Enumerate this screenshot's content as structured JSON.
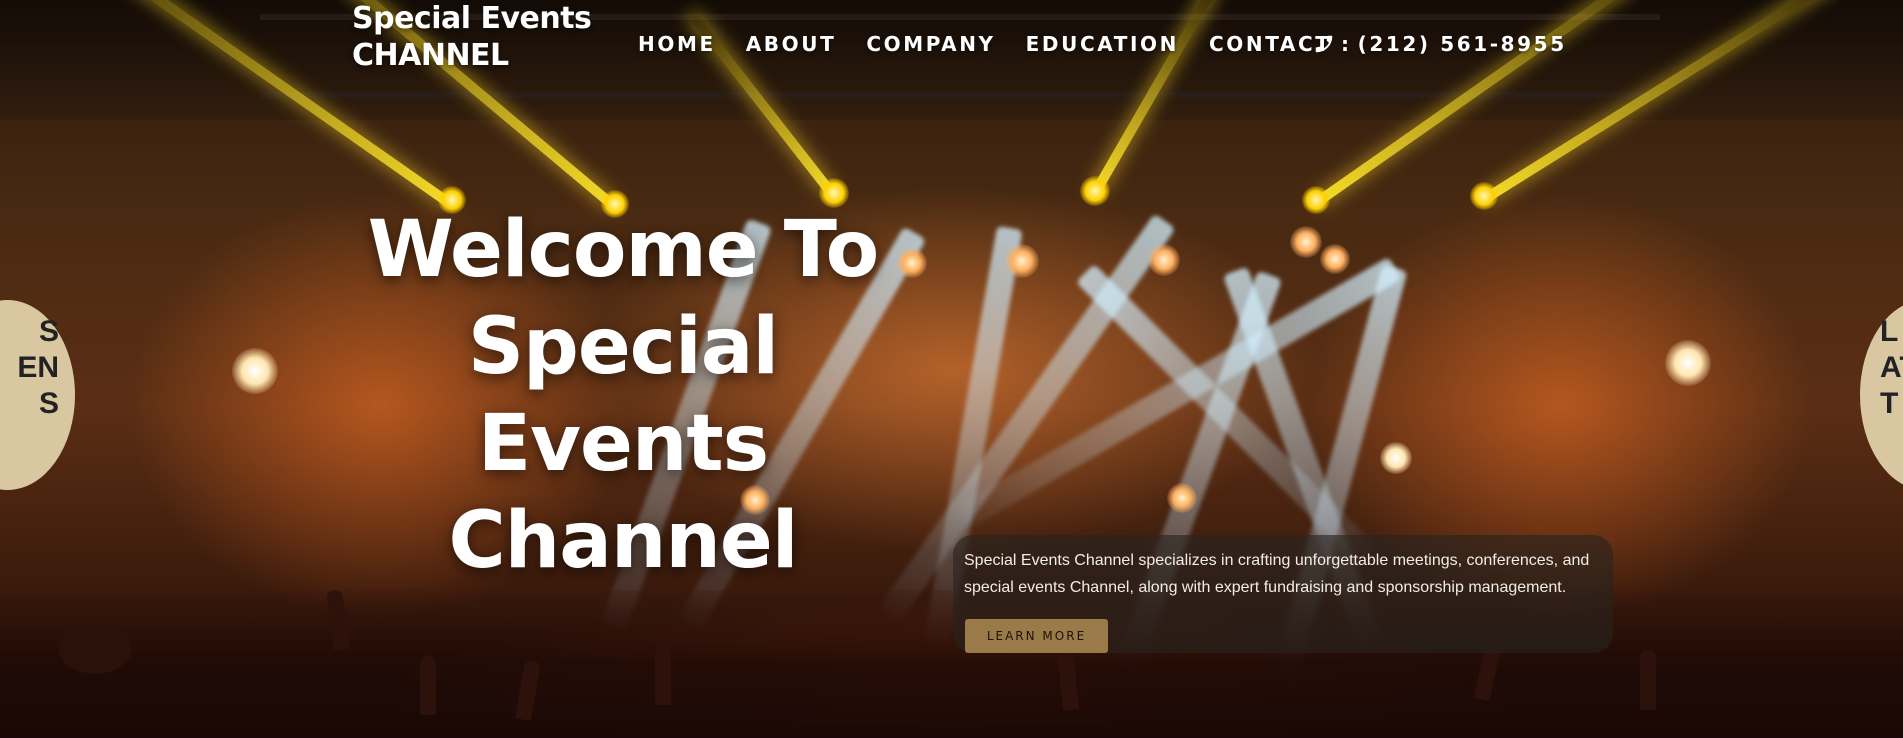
{
  "header": {
    "logo_line1": "Special Events",
    "logo_line2": "CHANNEL",
    "nav": [
      {
        "label": "HOME"
      },
      {
        "label": "ABOUT"
      },
      {
        "label": "COMPANY"
      },
      {
        "label": "EDUCATION"
      },
      {
        "label": "CONTACT"
      }
    ],
    "phone": {
      "icon": "phone-icon",
      "prefix": ":",
      "number": "(212) 561-8955"
    }
  },
  "hero": {
    "title_line1": "Welcome To",
    "title_line2": "Special Events",
    "title_line3": "Channel"
  },
  "card": {
    "description": "Special Events Channel specializes in crafting unforgettable meetings, conferences, and special events Channel, along with expert fundraising and sponsorship management.",
    "button_label": "LEARN MORE"
  },
  "background": {
    "banner_left": [
      "S",
      "EN",
      "S"
    ],
    "banner_right": [
      "L",
      "AT",
      "T"
    ]
  },
  "colors": {
    "accent_button": "#9a7a48",
    "card_bg": "rgba(40,35,30,0.62)",
    "text": "#ffffff"
  }
}
